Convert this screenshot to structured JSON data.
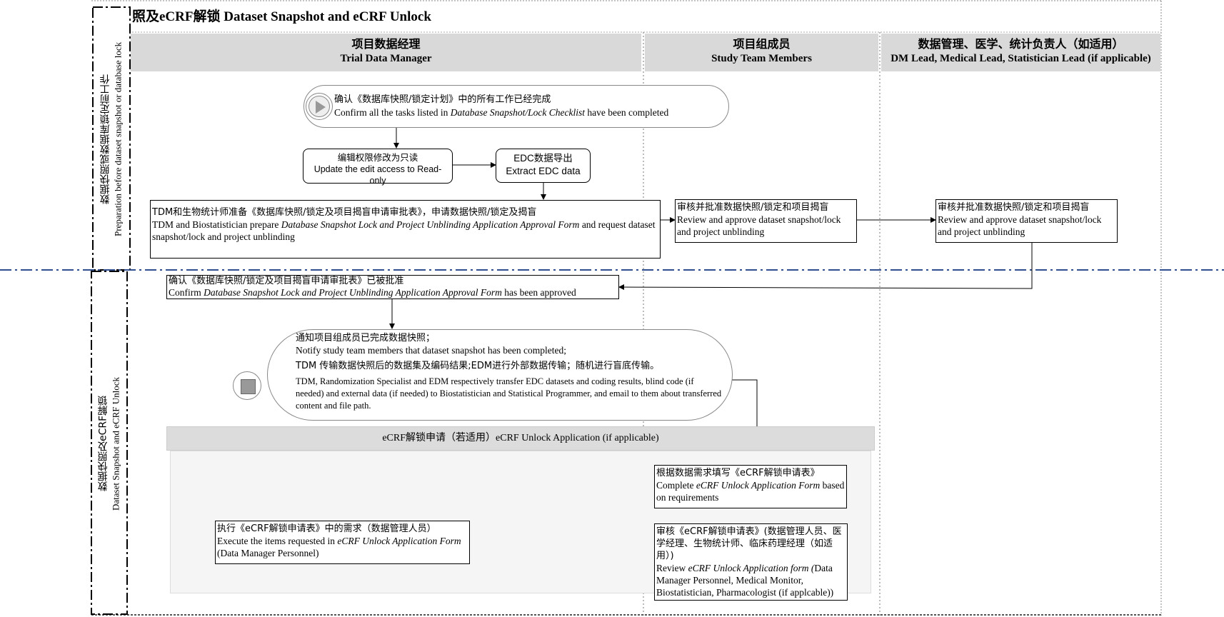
{
  "title": "照及eCRF解锁 Dataset Snapshot and eCRF Unlock",
  "columns": [
    {
      "cn": "项目数据经理",
      "en": "Trial Data Manager"
    },
    {
      "cn": "项目组成员",
      "en": "Study Team Members"
    },
    {
      "cn": "数据管理、医学、统计负责人（如适用）",
      "en": "DM Lead, Medical Lead, Statistician Lead (if applicable)"
    }
  ],
  "lanes": {
    "prep": {
      "cn": "数据快照或数据库锁定前工作",
      "en": "Preparation before dataset snapshot or database lock"
    },
    "snapshot": {
      "cn": "数据快照及eCRF解锁",
      "en": "Dataset Snapshot and eCRF Unlock"
    }
  },
  "nodes": {
    "start": {
      "cn": "确认《数据库快照/锁定计划》中的所有工作已经完成",
      "en_pre": "Confirm all the tasks listed in ",
      "en_it": "Database Snapshot/Lock Checklist",
      "en_post": " have been completed"
    },
    "edit_access": {
      "cn": "编辑权限修改为只读",
      "en": "Update the edit access to Read-only"
    },
    "extract": {
      "cn": "EDC数据导出",
      "en": "Extract EDC data"
    },
    "prepare": {
      "cn": "TDM和生物统计师准备《数据库快照/锁定及项目揭盲申请审批表》，申请数据快照/锁定及揭盲",
      "en_pre": "TDM and Biostatistician prepare ",
      "en_it": "Database Snapshot Lock and Project Unblinding Application Approval Form",
      "en_post": " and request dataset snapshot/lock and project unblinding"
    },
    "review_team": {
      "cn": "审核并批准数据快照/锁定和项目揭盲",
      "en": "Review and approve dataset snapshot/lock and project unblinding"
    },
    "review_lead": {
      "cn": "审核并批准数据快照/锁定和项目揭盲",
      "en": "Review and approve dataset snapshot/lock and project unblinding"
    },
    "confirm": {
      "cn": "确认《数据库快照/锁定及项目揭盲申请审批表》已被批准",
      "en_pre": "Confirm ",
      "en_it": "Database Snapshot Lock and Project Unblinding Application Approval Form",
      "en_post": " has been approved"
    },
    "notify": {
      "cn1": "通知项目组成员已完成数据快照；",
      "en1": "Notify study team members that dataset snapshot has been completed;",
      "cn2": "TDM 传输数据快照后的数据集及编码结果;EDM进行外部数据传输；随机进行盲底传输。",
      "en2": "TDM, Randomization Specialist and EDM respectively transfer EDC datasets and coding results, blind code (if needed) and external data (if needed) to Biostatistician and Statistical Programmer, and email to them about transferred content and file path."
    },
    "unlock_group": "eCRF解锁申请（若适用）eCRF Unlock Application (if applicable)",
    "fill_form": {
      "cn": "根据数据需求填写《eCRF解锁申请表》",
      "en_pre": "Complete ",
      "en_it": "eCRF Unlock Application Form",
      "en_post": " based on requirements"
    },
    "review_form": {
      "cn": "审核《eCRF解锁申请表》(数据管理人员、医学经理、生物统计师、临床药理经理（如适用）)",
      "en_pre": "Review ",
      "en_it": "eCRF Unlock Application form (",
      "en_post": "Data Manager Personnel, Medical Monitor, Biostatistician, Pharmacologist (if applcable))"
    },
    "execute": {
      "cn": "执行《eCRF解锁申请表》中的需求（数据管理人员）",
      "en_pre": "Execute the items requested in ",
      "en_it": "eCRF Unlock Application Form",
      "en_post": " (Data Manager Personnel)"
    }
  },
  "colors": {
    "header_bg": "#d9d9d9",
    "lane_divider": "#2f4f8f",
    "group_bg": "#f5f5f5"
  }
}
